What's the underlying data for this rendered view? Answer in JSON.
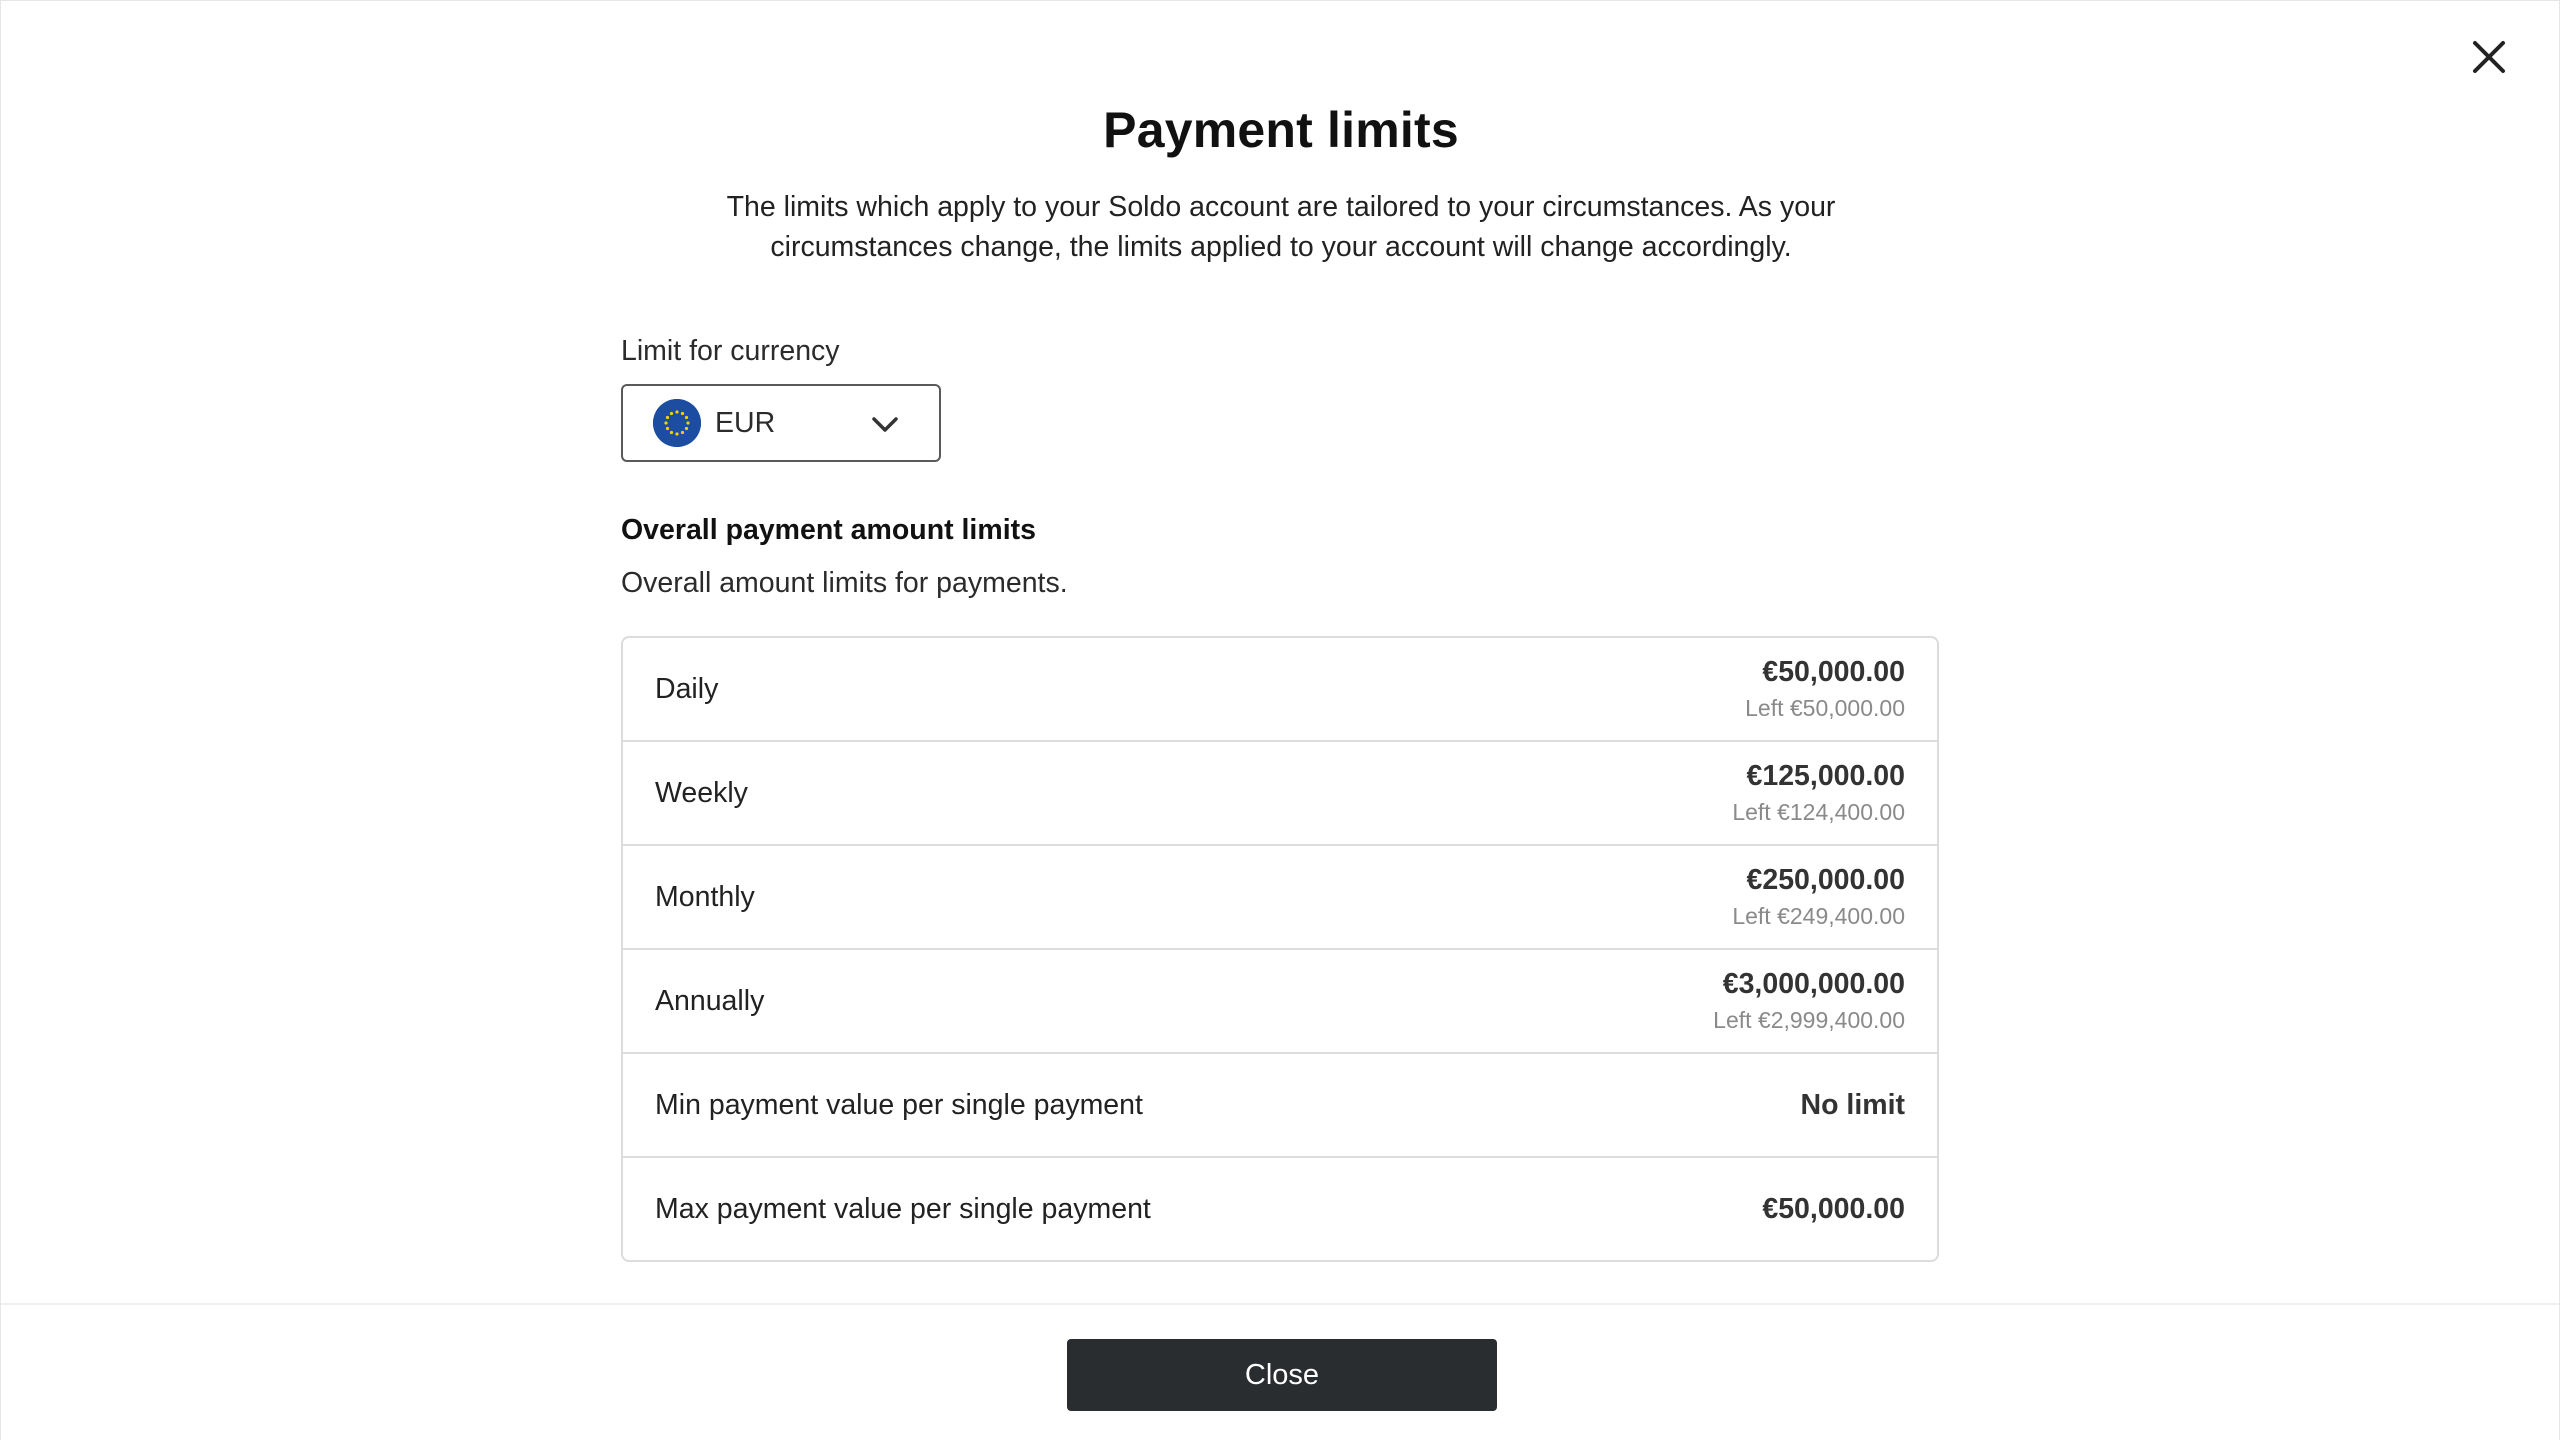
{
  "modal": {
    "title": "Payment limits",
    "description": "The limits which apply to your Soldo account are tailored to your circumstances. As your circumstances change, the limits applied to your account will change accordingly."
  },
  "currency": {
    "label": "Limit for currency",
    "selected": "EUR",
    "flag_icon": "eu-flag-icon",
    "flag_color": "#1c4da1"
  },
  "section": {
    "title": "Overall payment amount limits",
    "description": "Overall amount limits for payments."
  },
  "limits": [
    {
      "label": "Daily",
      "amount": "€50,000.00",
      "left": "Left €50,000.00"
    },
    {
      "label": "Weekly",
      "amount": "€125,000.00",
      "left": "Left €124,400.00"
    },
    {
      "label": "Monthly",
      "amount": "€250,000.00",
      "left": "Left €249,400.00"
    },
    {
      "label": "Annually",
      "amount": "€3,000,000.00",
      "left": "Left €2,999,400.00"
    },
    {
      "label": "Min payment value per single payment",
      "amount": "No limit"
    },
    {
      "label": "Max payment value per single payment",
      "amount": "€50,000.00"
    }
  ],
  "footer": {
    "close_label": "Close",
    "close_button_color": "#2a2d30"
  }
}
